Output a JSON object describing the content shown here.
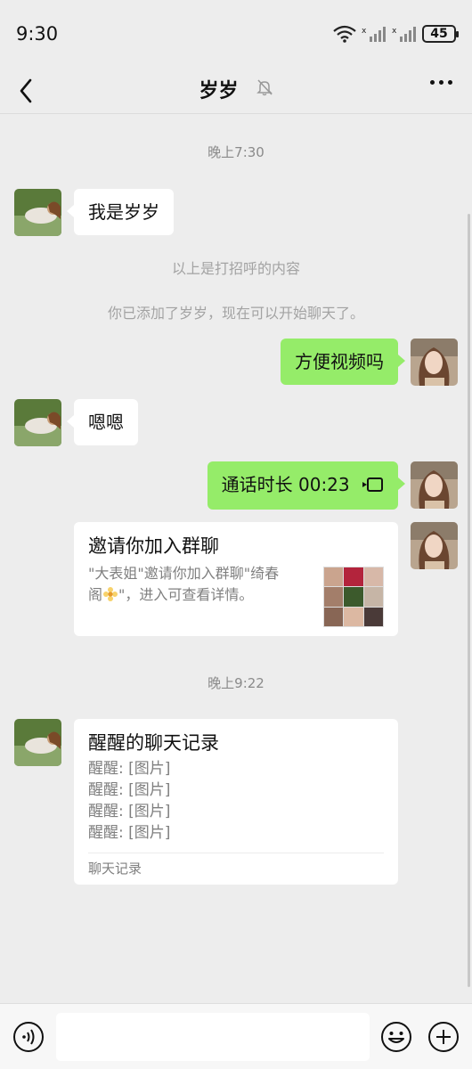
{
  "status_bar": {
    "time": "9:30",
    "battery": "45"
  },
  "header": {
    "title": "岁岁"
  },
  "messages": {
    "time_1": "晚上7:30",
    "m1": "我是岁岁",
    "sys1": "以上是打招呼的内容",
    "sys2": "你已添加了岁岁，现在可以开始聊天了。",
    "m2": "方便视频吗",
    "m3": "嗯嗯",
    "m4": "通话时长 00:23",
    "invite": {
      "title": "邀请你加入群聊",
      "desc_line1": "\"大表姐\"邀请你加入群聊\"绮春",
      "desc_line2_a": "阁",
      "desc_line2_b": "\"，进入可查看详情。"
    },
    "time_2": "晚上9:22",
    "record": {
      "title": "醒醒的聊天记录",
      "lines": [
        "醒醒: [图片]",
        "醒醒: [图片]",
        "醒醒: [图片]",
        "醒醒: [图片]"
      ],
      "footer": "聊天记录"
    }
  },
  "colors": {
    "background": "#ededed",
    "outgoing": "#95ec69",
    "incoming": "#ffffff"
  },
  "icons": [
    "wifi-icon",
    "signal-icon",
    "battery-icon",
    "back-icon",
    "mute-icon",
    "more-icon",
    "video-call-icon",
    "flower-emoji-icon",
    "voice-icon",
    "emoji-icon",
    "plus-icon"
  ]
}
